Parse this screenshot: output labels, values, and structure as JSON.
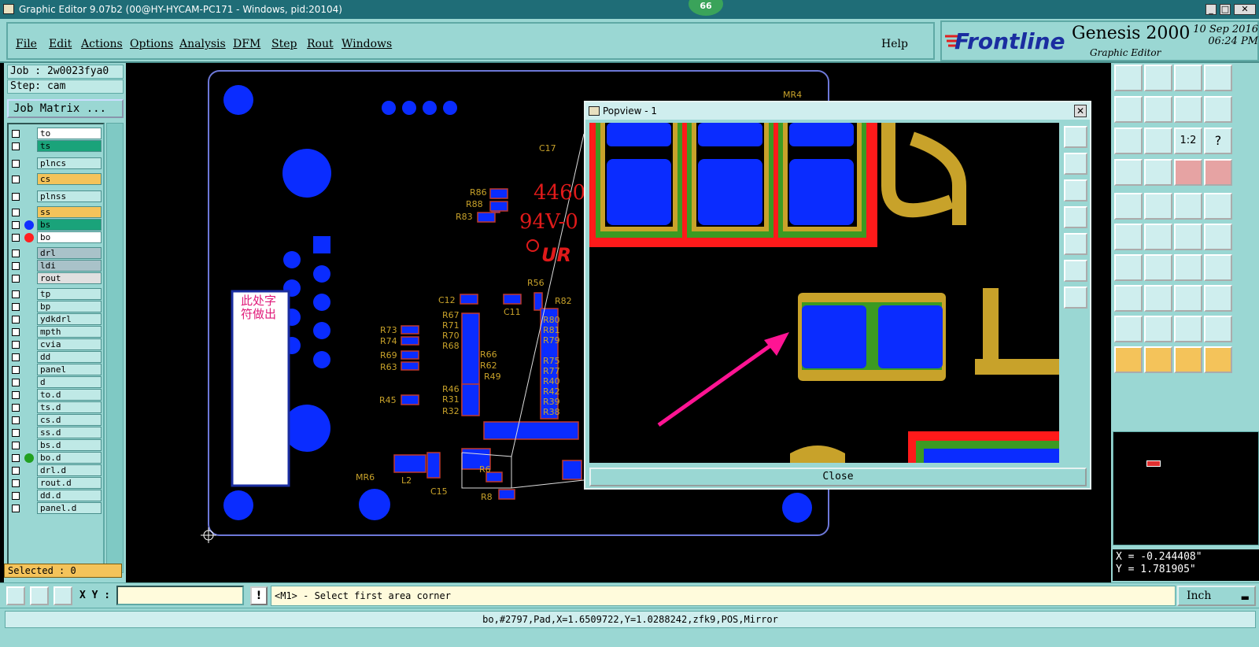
{
  "window": {
    "title": "Graphic Editor 9.07b2 (00@HY-HYCAM-PC171 - Windows, pid:20104)",
    "badge": "66"
  },
  "menu": [
    "File",
    "Edit",
    "Actions",
    "Options",
    "Analysis",
    "DFM",
    "Step",
    "Rout",
    "Windows"
  ],
  "help_label": "Help",
  "brand": {
    "logo": "Frontline",
    "product": "Genesis 2000",
    "subtitle": "Graphic Editor",
    "date": "10 Sep 2016",
    "time": "06:24 PM"
  },
  "job": {
    "job_line": "Job : 2w0023fya0",
    "step_line": "Step: cam",
    "matrix_button": "Job Matrix ..."
  },
  "layers": [
    {
      "name": "to",
      "bg": "#ffffff"
    },
    {
      "name": "ts",
      "bg": "#1aa37a"
    },
    {
      "name": "plncs",
      "bg": "#bfe9e6"
    },
    {
      "name": "cs",
      "bg": "#f4c35a"
    },
    {
      "name": "plnss",
      "bg": "#bfe9e6"
    },
    {
      "name": "ss",
      "bg": "#f4c35a"
    },
    {
      "name": "bs",
      "bg": "#1aa37a",
      "dot": "#1030ff"
    },
    {
      "name": "bo",
      "bg": "#ffffff",
      "dot": "#ff2020"
    },
    {
      "name": "drl",
      "bg": "#a9c2c9"
    },
    {
      "name": "ldi",
      "bg": "#a9c2c9"
    },
    {
      "name": "rout",
      "bg": "#e0e0e0"
    },
    {
      "name": "tp",
      "bg": "#bfe9e6"
    },
    {
      "name": "bp",
      "bg": "#bfe9e6"
    },
    {
      "name": "ydkdrl",
      "bg": "#bfe9e6"
    },
    {
      "name": "mpth",
      "bg": "#bfe9e6"
    },
    {
      "name": "cvia",
      "bg": "#bfe9e6"
    },
    {
      "name": "dd",
      "bg": "#bfe9e6"
    },
    {
      "name": "panel",
      "bg": "#bfe9e6"
    },
    {
      "name": "d",
      "bg": "#bfe9e6"
    },
    {
      "name": "to.d",
      "bg": "#bfe9e6"
    },
    {
      "name": "ts.d",
      "bg": "#bfe9e6"
    },
    {
      "name": "cs.d",
      "bg": "#bfe9e6"
    },
    {
      "name": "ss.d",
      "bg": "#bfe9e6"
    },
    {
      "name": "bs.d",
      "bg": "#bfe9e6"
    },
    {
      "name": "bo.d",
      "bg": "#bfe9e6",
      "dot": "#22a020"
    },
    {
      "name": "drl.d",
      "bg": "#bfe9e6"
    },
    {
      "name": "rout.d",
      "bg": "#bfe9e6"
    },
    {
      "name": "dd.d",
      "bg": "#bfe9e6"
    },
    {
      "name": "panel.d",
      "bg": "#bfe9e6"
    }
  ],
  "selected": "Selected : 0",
  "canvas": {
    "note_text": "此处字符做出",
    "silk_labels": [
      "C17",
      "R86",
      "R88",
      "R83",
      "R56",
      "C12",
      "C11",
      "R82",
      "R67",
      "R71",
      "R70",
      "R68",
      "R73",
      "R74",
      "R69",
      "R63",
      "R66",
      "R62",
      "R49",
      "R80",
      "R81",
      "R79",
      "R75",
      "R77",
      "R40",
      "R42",
      "R39",
      "R38",
      "R46",
      "R31",
      "R32",
      "R45",
      "L2",
      "C15",
      "R6",
      "R8",
      "MR6",
      "MR4",
      "4460",
      "94V-0"
    ]
  },
  "popview": {
    "title": "Popview - 1",
    "close_label": "Close"
  },
  "coords": {
    "x": "X = -0.244408\"",
    "y": "Y = 1.781905\""
  },
  "cmd": {
    "xy_label": "X Y :",
    "xy_value": "",
    "bang": "!",
    "prompt": "<M1> - Select first area corner",
    "unit": "Inch"
  },
  "status": "bo,#2797,Pad,X=1.6509722,Y=1.0288242,zfk9,POS,Mirror",
  "colors": {
    "board_blue": "#0a2cff",
    "silk_gold": "#c8a22a",
    "mask_red": "#ff1a1a",
    "trace_green": "#3c9a22",
    "arrow": "#ff1493",
    "panel": "#9ad7d3"
  }
}
